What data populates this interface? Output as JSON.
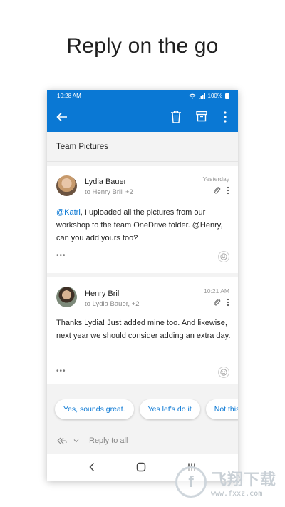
{
  "headline": "Reply on the go",
  "status_bar": {
    "time": "10:28 AM",
    "battery": "100%"
  },
  "thread": {
    "subject": "Team Pictures"
  },
  "messages": [
    {
      "sender": "Lydia Bauer",
      "recipients": "to Henry Brill +2",
      "time": "Yesterday",
      "mention": "@Katri",
      "body": ", I uploaded all the pictures from our workshop to the team OneDrive folder. @Henry, can you add yours too?",
      "more_indicator": "•••"
    },
    {
      "sender": "Henry Brill",
      "recipients": "to Lydia Bauer, +2",
      "time": "10:21 AM",
      "body": "Thanks Lydia! Just added mine too. And likewise, next year we should consider adding an extra day.",
      "more_indicator": "•••"
    }
  ],
  "suggested_replies": [
    "Yes, sounds great.",
    "Yes let's do it",
    "Not this"
  ],
  "reply_bar": {
    "label": "Reply to all"
  },
  "watermark": {
    "text": "飞翔下载",
    "url": "www.fxxz.com"
  },
  "colors": {
    "accent": "#0a78d4",
    "background": "#f3f3f3"
  },
  "icons": [
    "back-arrow-icon",
    "trash-icon",
    "archive-icon",
    "more-vert-icon",
    "attachment-icon",
    "emoji-icon",
    "reply-all-icon",
    "nav-back-icon",
    "nav-home-icon",
    "nav-recents-icon"
  ]
}
